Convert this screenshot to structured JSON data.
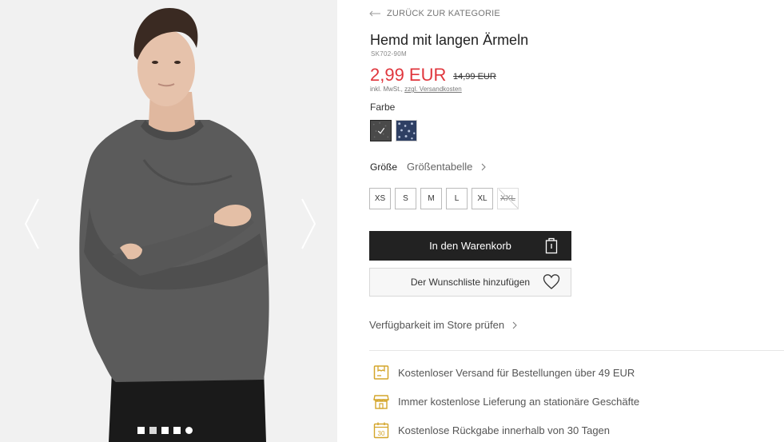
{
  "gallery": {
    "prev_icon": "chevron-left-icon",
    "next_icon": "chevron-right-icon",
    "dots_count": 5,
    "active_dot": 1
  },
  "product": {
    "back_label": "ZURÜCK ZUR KATEGORIE",
    "title": "Hemd mit langen Ärmeln",
    "sku": "SK702-90M",
    "price": "2,99 EUR",
    "old_price": "14,99 EUR",
    "tax_prefix": "inkl. MwSt., ",
    "tax_link": "zzgl. Versandkosten",
    "price_color": "#e0363d"
  },
  "color": {
    "label": "Farbe",
    "swatches": [
      {
        "name": "grau-meliert",
        "selected": true
      },
      {
        "name": "blau-gemustert",
        "selected": false
      }
    ]
  },
  "size": {
    "label": "Größe",
    "table_link": "Größentabelle",
    "options": [
      {
        "label": "XS",
        "available": true
      },
      {
        "label": "S",
        "available": true
      },
      {
        "label": "M",
        "available": true
      },
      {
        "label": "L",
        "available": true
      },
      {
        "label": "XL",
        "available": true
      },
      {
        "label": "XXL",
        "available": false
      }
    ]
  },
  "actions": {
    "cart_label": "In den Warenkorb",
    "wishlist_label": "Der Wunschliste hinzufügen",
    "availability_label": "Verfügbarkeit im Store prüfen"
  },
  "benefits": [
    {
      "icon": "shipping-box-icon",
      "text": "Kostenloser Versand für Bestellungen über 49 EUR"
    },
    {
      "icon": "store-icon",
      "text": "Immer kostenlose Lieferung an stationäre Geschäfte"
    },
    {
      "icon": "calendar-30-icon",
      "text": "Kostenlose Rückgabe innerhalb von 30 Tagen"
    }
  ],
  "colors": {
    "accent_gold": "#d4a52a",
    "button_dark": "#222222"
  }
}
